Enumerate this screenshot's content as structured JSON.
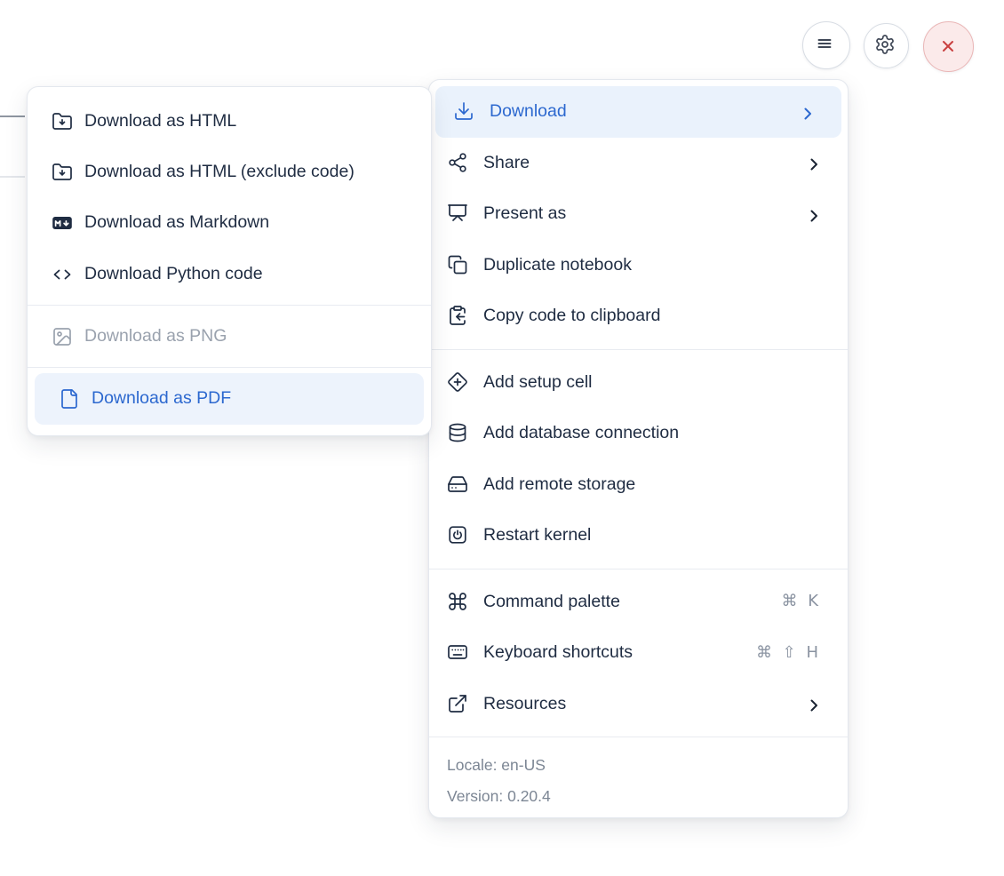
{
  "colors": {
    "accent_blue": "#2c68cf",
    "highlight_bg": "#eaf2fc",
    "text": "#1f2c42",
    "disabled_text": "#9aa2ae",
    "shortcut_text": "#8a93a1",
    "footer_text": "#7c8694",
    "close_red": "#c94040",
    "close_bg": "#fbeaea",
    "separator": "#e8ebf1"
  },
  "toolbar": {
    "buttons": [
      {
        "id": "menu",
        "icon": "hamburger-icon"
      },
      {
        "id": "settings",
        "icon": "gear-icon"
      },
      {
        "id": "close",
        "icon": "close-icon"
      }
    ]
  },
  "download_submenu": {
    "items": [
      {
        "label": "Download as HTML",
        "icon": "folder-down-icon",
        "state": "normal"
      },
      {
        "label": "Download as HTML (exclude code)",
        "icon": "folder-down-icon",
        "state": "normal"
      },
      {
        "label": "Download as Markdown",
        "icon": "markdown-icon",
        "state": "normal"
      },
      {
        "label": "Download Python code",
        "icon": "code-icon",
        "state": "normal"
      },
      {
        "label": "Download as PNG",
        "icon": "image-icon",
        "state": "disabled"
      },
      {
        "label": "Download as PDF",
        "icon": "file-icon",
        "state": "highlighted"
      }
    ]
  },
  "main_menu": {
    "sections": [
      {
        "items": [
          {
            "label": "Download",
            "icon": "download-icon",
            "has_submenu": true,
            "state": "highlighted"
          },
          {
            "label": "Share",
            "icon": "share-icon",
            "has_submenu": true
          },
          {
            "label": "Present as",
            "icon": "presentation-icon",
            "has_submenu": true
          },
          {
            "label": "Duplicate notebook",
            "icon": "copy-icon"
          },
          {
            "label": "Copy code to clipboard",
            "icon": "clipboard-copy-icon"
          }
        ]
      },
      {
        "items": [
          {
            "label": "Add setup cell",
            "icon": "diamond-plus-icon"
          },
          {
            "label": "Add database connection",
            "icon": "database-icon"
          },
          {
            "label": "Add remote storage",
            "icon": "hard-drive-icon"
          },
          {
            "label": "Restart kernel",
            "icon": "power-icon"
          }
        ]
      },
      {
        "items": [
          {
            "label": "Command palette",
            "icon": "command-icon",
            "shortcut": "⌘ K"
          },
          {
            "label": "Keyboard shortcuts",
            "icon": "keyboard-icon",
            "shortcut": "⌘ ⇧ H"
          },
          {
            "label": "Resources",
            "icon": "external-link-icon",
            "has_submenu": true
          }
        ]
      }
    ],
    "footer": {
      "locale": "Locale: en-US",
      "version": "Version: 0.20.4"
    }
  }
}
